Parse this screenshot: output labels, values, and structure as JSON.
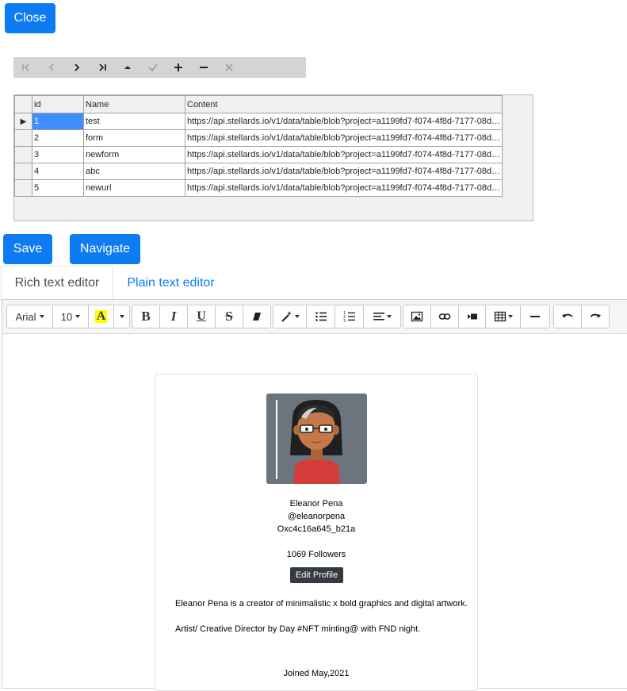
{
  "buttons": {
    "close": "Close",
    "save": "Save",
    "navigate": "Navigate"
  },
  "navigator": {
    "items": [
      {
        "name": "first-record-icon",
        "enabled": false
      },
      {
        "name": "prev-record-icon",
        "enabled": false
      },
      {
        "name": "next-record-icon",
        "enabled": true
      },
      {
        "name": "last-record-icon",
        "enabled": true
      },
      {
        "name": "move-up-icon",
        "enabled": true
      },
      {
        "name": "check-icon",
        "enabled": false
      },
      {
        "name": "plus-icon",
        "enabled": true
      },
      {
        "name": "minus-icon",
        "enabled": true
      },
      {
        "name": "cancel-x-icon",
        "enabled": false
      }
    ]
  },
  "grid": {
    "columns": [
      "id",
      "Name",
      "Content"
    ],
    "rows": [
      {
        "id": "1",
        "name": "test",
        "content": "https://api.stellards.io/v1/data/table/blob?project=a1199fd7-f074-4f8d-7177-08dcc..."
      },
      {
        "id": "2",
        "name": "form",
        "content": "https://api.stellards.io/v1/data/table/blob?project=a1199fd7-f074-4f8d-7177-08dcc..."
      },
      {
        "id": "3",
        "name": "newform",
        "content": "https://api.stellards.io/v1/data/table/blob?project=a1199fd7-f074-4f8d-7177-08dcc..."
      },
      {
        "id": "4",
        "name": "abc",
        "content": "https://api.stellards.io/v1/data/table/blob?project=a1199fd7-f074-4f8d-7177-08dcc..."
      },
      {
        "id": "5",
        "name": "newurl",
        "content": "https://api.stellards.io/v1/data/table/blob?project=a1199fd7-f074-4f8d-7177-08dcc..."
      }
    ],
    "current_row_marker": "▶"
  },
  "tabs": {
    "rich": "Rich text editor",
    "plain": "Plain text editor"
  },
  "editor_toolbar": {
    "font": "Arial",
    "size": "10",
    "highlight_letter": "A"
  },
  "profile": {
    "name": "Eleanor Pena",
    "handle": "@eleanorpena",
    "wallet": "Oxc4c16a645_b21a",
    "followers": "1069 Followers",
    "edit_label": "Edit Profile",
    "bio1": "Eleanor Pena is a creator of minimalistic x bold graphics and digital artwork.",
    "bio2": "Artist/ Creative Director by Day #NFT minting@ with FND night.",
    "joined": "Joined May,2021"
  },
  "colors": {
    "primary": "#0d7cf2",
    "avatar_bg": "#6c757d",
    "dark_button": "#343a40"
  }
}
